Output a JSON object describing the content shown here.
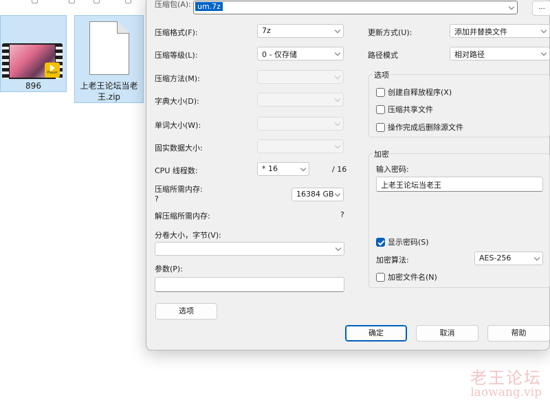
{
  "explorer": {
    "files": [
      {
        "name": "896"
      },
      {
        "name": "上老王论坛当老王.zip"
      }
    ],
    "video_badge": "Player"
  },
  "dialog": {
    "archive_label": "压缩包(A):",
    "archive_value": "um.7z",
    "browse_label": "...",
    "left": {
      "format_label": "压缩格式(F):",
      "format_value": "7z",
      "level_label": "压缩等级(L):",
      "level_value": "0 - 仅存储",
      "method_label": "压缩方法(M):",
      "dict_label": "字典大小(D):",
      "word_label": "单词大小(W):",
      "solid_label": "固实数据大小:",
      "cpu_label": "CPU 线程数:",
      "cpu_value": "* 16",
      "cpu_total": "/ 16",
      "mem_comp_label": "压缩所需内存:",
      "mem_comp_q": "?",
      "mem_comp_value": "16384 GB",
      "mem_decomp_label": "解压缩所需内存:",
      "mem_decomp_value": "?",
      "split_label": "分卷大小，字节(V):",
      "params_label": "参数(P):",
      "options_button": "选项"
    },
    "right": {
      "update_label": "更新方式(U):",
      "update_value": "添加并替换文件",
      "path_label": "路径模式",
      "path_value": "相对路径",
      "options_group": "选项",
      "opt_sfx": "创建自释放程序(X)",
      "opt_shared": "压缩共享文件",
      "opt_delete": "操作完成后删除源文件",
      "encrypt_group": "加密",
      "password_label": "输入密码:",
      "password_value": "上老王论坛当老王",
      "show_password": "显示密码(S)",
      "enc_method_label": "加密算法:",
      "enc_method_value": "AES-256",
      "encrypt_names": "加密文件名(N)"
    },
    "buttons": {
      "ok": "确定",
      "cancel": "取消",
      "help": "帮助"
    }
  },
  "watermark": {
    "line1": "老王论坛",
    "line2": "laowang.vip"
  }
}
